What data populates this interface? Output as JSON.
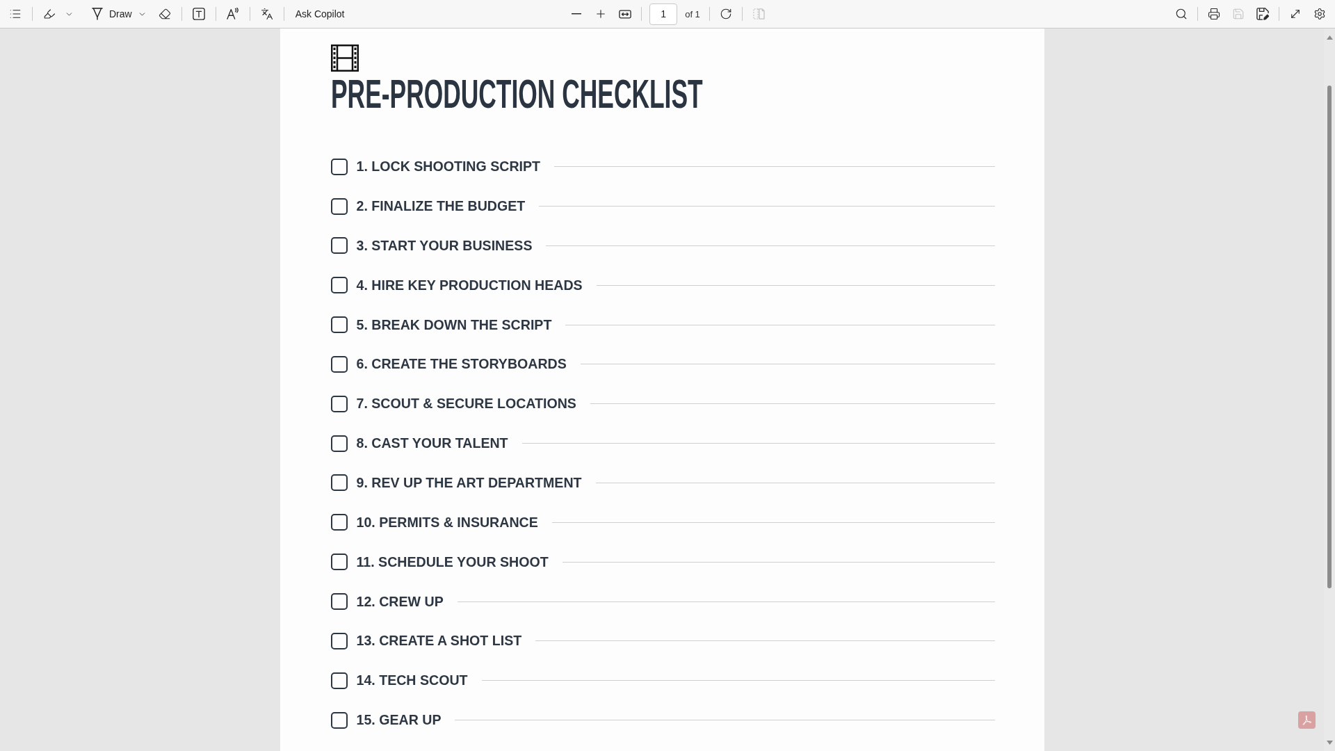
{
  "toolbar": {
    "draw": {
      "label": "Draw"
    },
    "ask_copilot": {
      "label": "Ask Copilot"
    },
    "page_field": {
      "value": "1"
    },
    "page_count": "of 1",
    "page_view": {
      "disabled": true
    },
    "save": {
      "disabled": true
    }
  },
  "document": {
    "title": "PRE-PRODUCTION CHECKLIST",
    "items": [
      {
        "label": "1. LOCK SHOOTING SCRIPT",
        "checked": false
      },
      {
        "label": "2. FINALIZE THE BUDGET",
        "checked": false
      },
      {
        "label": "3. START YOUR BUSINESS",
        "checked": false
      },
      {
        "label": "4. HIRE KEY PRODUCTION HEADS",
        "checked": false
      },
      {
        "label": "5. BREAK DOWN THE SCRIPT",
        "checked": false
      },
      {
        "label": "6. CREATE THE STORYBOARDS",
        "checked": false
      },
      {
        "label": "7. SCOUT & SECURE LOCATIONS",
        "checked": false
      },
      {
        "label": "8. CAST YOUR TALENT",
        "checked": false
      },
      {
        "label": "9. REV UP THE ART DEPARTMENT",
        "checked": false
      },
      {
        "label": "10. PERMITS & INSURANCE",
        "checked": false
      },
      {
        "label": "11. SCHEDULE YOUR SHOOT",
        "checked": false
      },
      {
        "label": "12. CREW UP",
        "checked": false
      },
      {
        "label": "13. CREATE A SHOT LIST",
        "checked": false
      },
      {
        "label": "14. TECH SCOUT",
        "checked": false
      },
      {
        "label": "15. GEAR UP",
        "checked": false
      }
    ]
  }
}
